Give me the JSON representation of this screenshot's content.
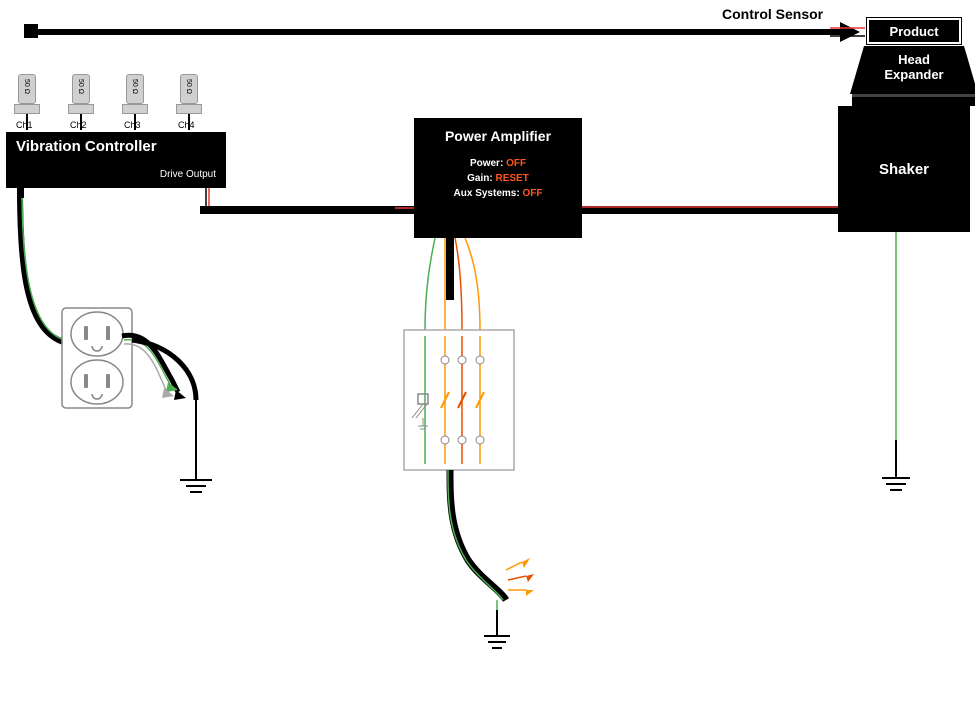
{
  "sensor_label": "Control Sensor",
  "product": "Product",
  "head_expander_top": "Head",
  "head_expander_bottom": "Expander",
  "shaker": "Shaker",
  "controller": {
    "title": "Vibration Controller",
    "drive": "Drive Output",
    "ch1": "Ch1",
    "ch2": "Ch2",
    "ch3": "Ch3",
    "ch4": "Ch4",
    "impedance": "50 Ω"
  },
  "amp": {
    "title": "Power Amplifier",
    "power_label": "Power:",
    "power_val": "OFF",
    "gain_label": "Gain:",
    "gain_val": "RESET",
    "aux_label": "Aux Systems:",
    "aux_val": "OFF"
  },
  "colors": {
    "off": "#FF5722"
  }
}
